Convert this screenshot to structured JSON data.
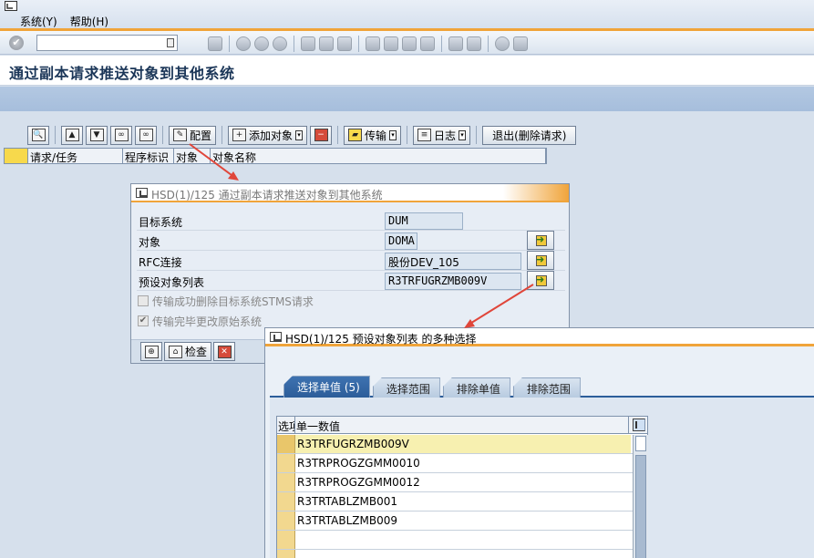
{
  "menu": {
    "system": "系统(Y)",
    "help": "帮助(H)"
  },
  "page": {
    "title": "通过副本请求推送对象到其他系统"
  },
  "app_toolbar": {
    "config": "配置",
    "add_object": "添加对象",
    "transport": "传输",
    "log": "日志",
    "exit": "退出(删除请求)"
  },
  "columns": [
    "请求/任务",
    "程序标识",
    "对象",
    "对象名称"
  ],
  "dialog1": {
    "title": "HSD(1)/125 通过副本请求推送对象到其他系统",
    "fields": [
      {
        "label": "目标系统",
        "value": "DUM"
      },
      {
        "label": "对象",
        "value": "DOMA"
      },
      {
        "label": "RFC连接",
        "value": "股份DEV_105"
      },
      {
        "label": "预设对象列表",
        "value": "R3TRFUGRZMB009V"
      }
    ],
    "checkbox1": "传输成功删除目标系统STMS请求",
    "checkbox2": "传输完毕更改原始系统",
    "check_button": "检查"
  },
  "dialog2": {
    "title": "HSD(1)/125 预设对象列表 的多种选择",
    "tabs": [
      "选择单值 (5)",
      "选择范围",
      "排除单值",
      "排除范围"
    ],
    "grid_headers": [
      "选项",
      "单一数值"
    ],
    "rows": [
      "R3TRFUGRZMB009V",
      "R3TRPROGZGMM0010",
      "R3TRPROGZGMM0012",
      "R3TRTABLZMB001",
      "R3TRTABLZMB009"
    ]
  },
  "colors": {
    "accent_orange": "#f0a43a",
    "active_tab": "#2c5d9a",
    "annotation_red": "#e0463a"
  }
}
